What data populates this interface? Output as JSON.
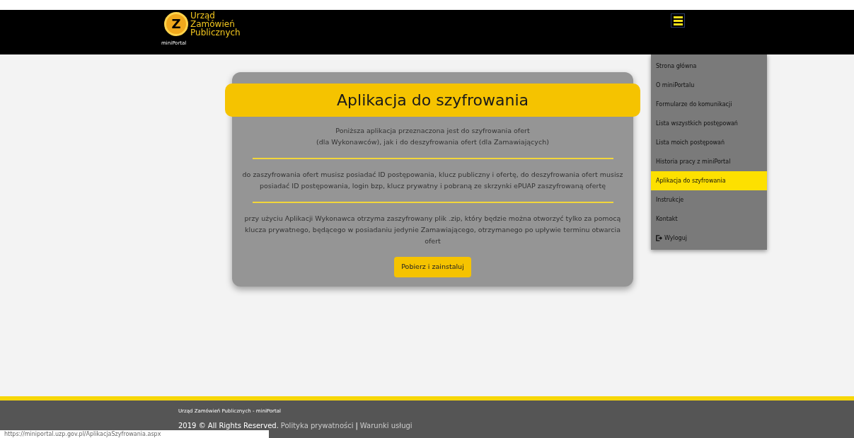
{
  "header": {
    "logo_lines": [
      "Urząd",
      "Zamówień",
      "Publicznych"
    ],
    "logo_letter": "Z",
    "sub_label": "miniPortal"
  },
  "menu": {
    "items": [
      {
        "label": "Strona główna",
        "selected": false,
        "kind": "link"
      },
      {
        "label": "O miniPortalu",
        "selected": false,
        "kind": "link"
      },
      {
        "label": "Formularze do komunikacji",
        "selected": false,
        "kind": "link"
      },
      {
        "label": "Lista wszystkich postępowań",
        "selected": false,
        "kind": "link"
      },
      {
        "label": "Lista moich postępowań",
        "selected": false,
        "kind": "link"
      },
      {
        "label": "Historia pracy z miniPortal",
        "selected": false,
        "kind": "link"
      },
      {
        "label": "Aplikacja do szyfrowania",
        "selected": true,
        "kind": "link"
      },
      {
        "label": "Instrukcje",
        "selected": false,
        "kind": "link"
      },
      {
        "label": "Kontakt",
        "selected": false,
        "kind": "link"
      },
      {
        "label": "Wyloguj",
        "selected": false,
        "kind": "logout"
      }
    ]
  },
  "card": {
    "title": "Aplikacja do szyfrowania",
    "paragraphs": [
      "Poniższa aplikacja przeznaczona jest do szyfrowania ofert\n(dla Wykonawców), jak i do deszyfrowania ofert (dla Zamawiających)",
      "do zaszyfrowania ofert musisz posiadać ID postępowania, klucz publiczny i ofertę, do deszyfrowania ofert musisz posiadać ID postępowania, login bzp, klucz prywatny i pobraną ze skrzynki ePUAP zaszyfrowaną ofertę",
      "przy użyciu Aplikacji Wykonawca otrzyma zaszyfrowany plik .zip, który będzie można otworzyć tylko za pomocą klucza prywatnego, będącego w posiadaniu jedynie Zamawiającego, otrzymanego po upływie terminu otwarcia ofert"
    ],
    "button": "Pobierz i zainstaluj"
  },
  "footer": {
    "title": "Urząd Zamówień Publicznych - miniPortal",
    "copyright": "2019 © All Rights Reserved.",
    "links": [
      "Polityka prywatności",
      "Warunki usługi"
    ],
    "separator": "|"
  },
  "status_url": "https://miniportal.uzp.gov.pl/AplikacjaSzyfrowania.aspx"
}
